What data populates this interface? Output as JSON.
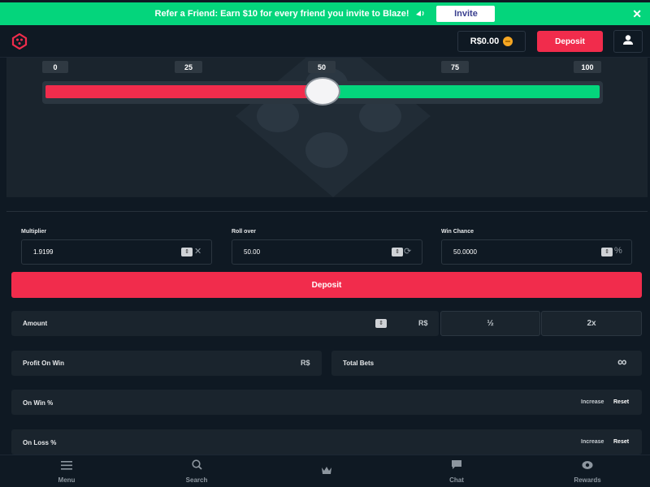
{
  "banner": {
    "text": "Refer a Friend: Earn $10 for every friend you invite to Blaze!",
    "icon": "loudspeaker-icon",
    "invite_label": "Invite",
    "close_label": "✕"
  },
  "header": {
    "balance": "R$0.00",
    "deposit_label": "Deposit"
  },
  "slider": {
    "ticks": [
      "0",
      "25",
      "50",
      "75",
      "100"
    ],
    "value": 50,
    "min": 0,
    "max": 100
  },
  "fields": {
    "multiplier": {
      "label": "Multiplier",
      "value": "1.9199",
      "suffix": "✕"
    },
    "roll_over": {
      "label": "Roll over",
      "value": "50.00",
      "suffix": "⟳"
    },
    "win_chance": {
      "label": "Win Chance",
      "value": "50.0000",
      "suffix": "%"
    }
  },
  "deposit_button": "Deposit",
  "amount": {
    "label": "Amount",
    "currency": "R$",
    "half_label": "½",
    "double_label": "2x"
  },
  "profit": {
    "label": "Profit On Win",
    "currency": "R$"
  },
  "total_bets": {
    "label": "Total Bets",
    "value": "∞"
  },
  "on_win": {
    "label": "On Win %",
    "increase": "Increase",
    "reset": "Reset"
  },
  "on_loss": {
    "label": "On Loss %",
    "increase": "Increase",
    "reset": "Reset"
  },
  "nav": [
    {
      "label": "Menu",
      "icon": "hamburger-icon"
    },
    {
      "label": "Search",
      "icon": "search-icon"
    },
    {
      "label": "",
      "icon": "crown-icon"
    },
    {
      "label": "Chat",
      "icon": "chat-icon"
    },
    {
      "label": "Rewards",
      "icon": "rewards-icon"
    }
  ],
  "colors": {
    "background": "#0f1923",
    "panel": "#1a242d",
    "accent_red": "#f12c4c",
    "accent_green": "#04d57c"
  }
}
